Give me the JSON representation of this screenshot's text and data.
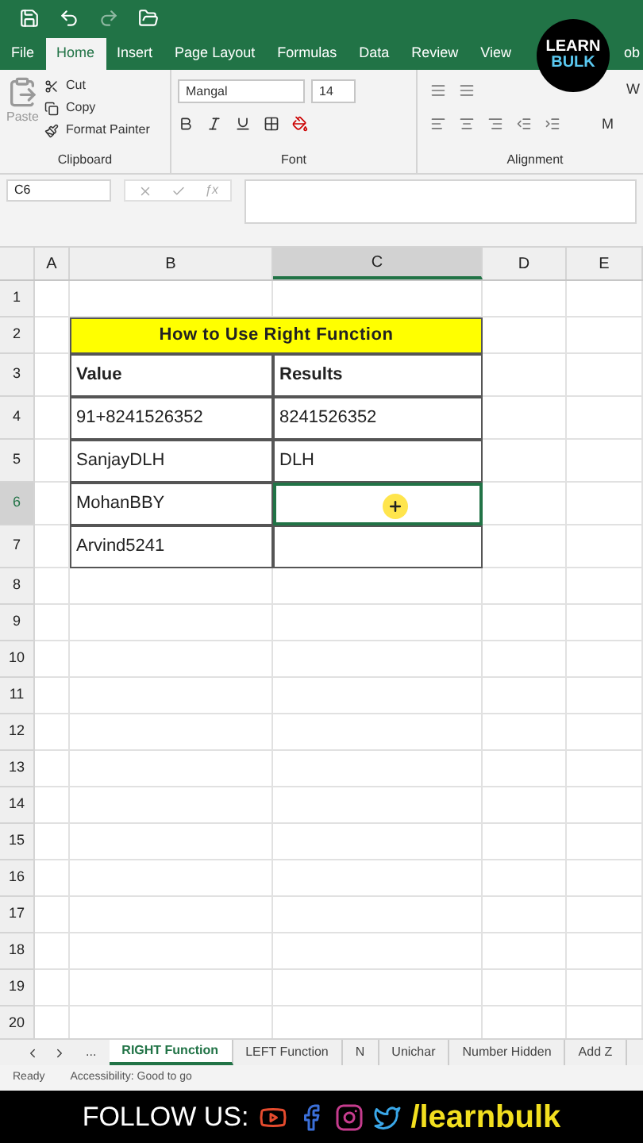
{
  "ribbon_tabs": [
    {
      "label": "File",
      "selected": false
    },
    {
      "label": "Home",
      "selected": true
    },
    {
      "label": "Insert",
      "selected": false
    },
    {
      "label": "Page Layout",
      "selected": false
    },
    {
      "label": "Formulas",
      "selected": false
    },
    {
      "label": "Data",
      "selected": false
    },
    {
      "label": "Review",
      "selected": false
    },
    {
      "label": "View",
      "selected": false
    },
    {
      "label": "ob",
      "selected": false
    }
  ],
  "logo": {
    "line1": "LEARN",
    "line2": "BULK"
  },
  "clipboard": {
    "paste": "Paste",
    "cut": "Cut",
    "copy": "Copy",
    "format_painter": "Format Painter",
    "group": "Clipboard"
  },
  "font": {
    "name": "Mangal",
    "size": "14",
    "group": "Font"
  },
  "alignment": {
    "group": "Alignment",
    "wrap": "W",
    "merge": "M"
  },
  "name_box": "C6",
  "function_label": "ƒx",
  "columns": [
    {
      "label": "A",
      "selected": false
    },
    {
      "label": "B",
      "selected": false
    },
    {
      "label": "C",
      "selected": true
    },
    {
      "label": "D",
      "selected": false
    },
    {
      "label": "E",
      "selected": false
    }
  ],
  "rows": [
    {
      "label": "1",
      "selected": false
    },
    {
      "label": "2",
      "selected": false
    },
    {
      "label": "3",
      "selected": false
    },
    {
      "label": "4",
      "selected": false
    },
    {
      "label": "5",
      "selected": false
    },
    {
      "label": "6",
      "selected": true
    },
    {
      "label": "7",
      "selected": false
    },
    {
      "label": "8",
      "selected": false
    },
    {
      "label": "9",
      "selected": false
    },
    {
      "label": "10",
      "selected": false
    },
    {
      "label": "11",
      "selected": false
    },
    {
      "label": "12",
      "selected": false
    },
    {
      "label": "13",
      "selected": false
    },
    {
      "label": "14",
      "selected": false
    },
    {
      "label": "15",
      "selected": false
    },
    {
      "label": "16",
      "selected": false
    },
    {
      "label": "17",
      "selected": false
    },
    {
      "label": "18",
      "selected": false
    },
    {
      "label": "19",
      "selected": false
    },
    {
      "label": "20",
      "selected": false
    }
  ],
  "table": {
    "title": "How to Use Right Function",
    "headers": [
      "Value",
      "Results"
    ],
    "rows": [
      [
        "91+8241526352",
        "8241526352"
      ],
      [
        "SanjayDLH",
        "DLH"
      ],
      [
        "MohanBBY",
        ""
      ],
      [
        "Arvind5241",
        ""
      ]
    ]
  },
  "sheet_nav": "...",
  "sheet_tabs": [
    {
      "label": "RIGHT Function",
      "selected": true
    },
    {
      "label": "LEFT Function",
      "selected": false
    },
    {
      "label": "N",
      "selected": false
    },
    {
      "label": "Unichar",
      "selected": false
    },
    {
      "label": "Number Hidden",
      "selected": false
    },
    {
      "label": "Add Z",
      "selected": false
    }
  ],
  "status": {
    "ready": "Ready",
    "accessibility": "Accessibility: Good to go"
  },
  "footer": {
    "follow": "FOLLOW US:",
    "handle": "/learnbulk"
  }
}
